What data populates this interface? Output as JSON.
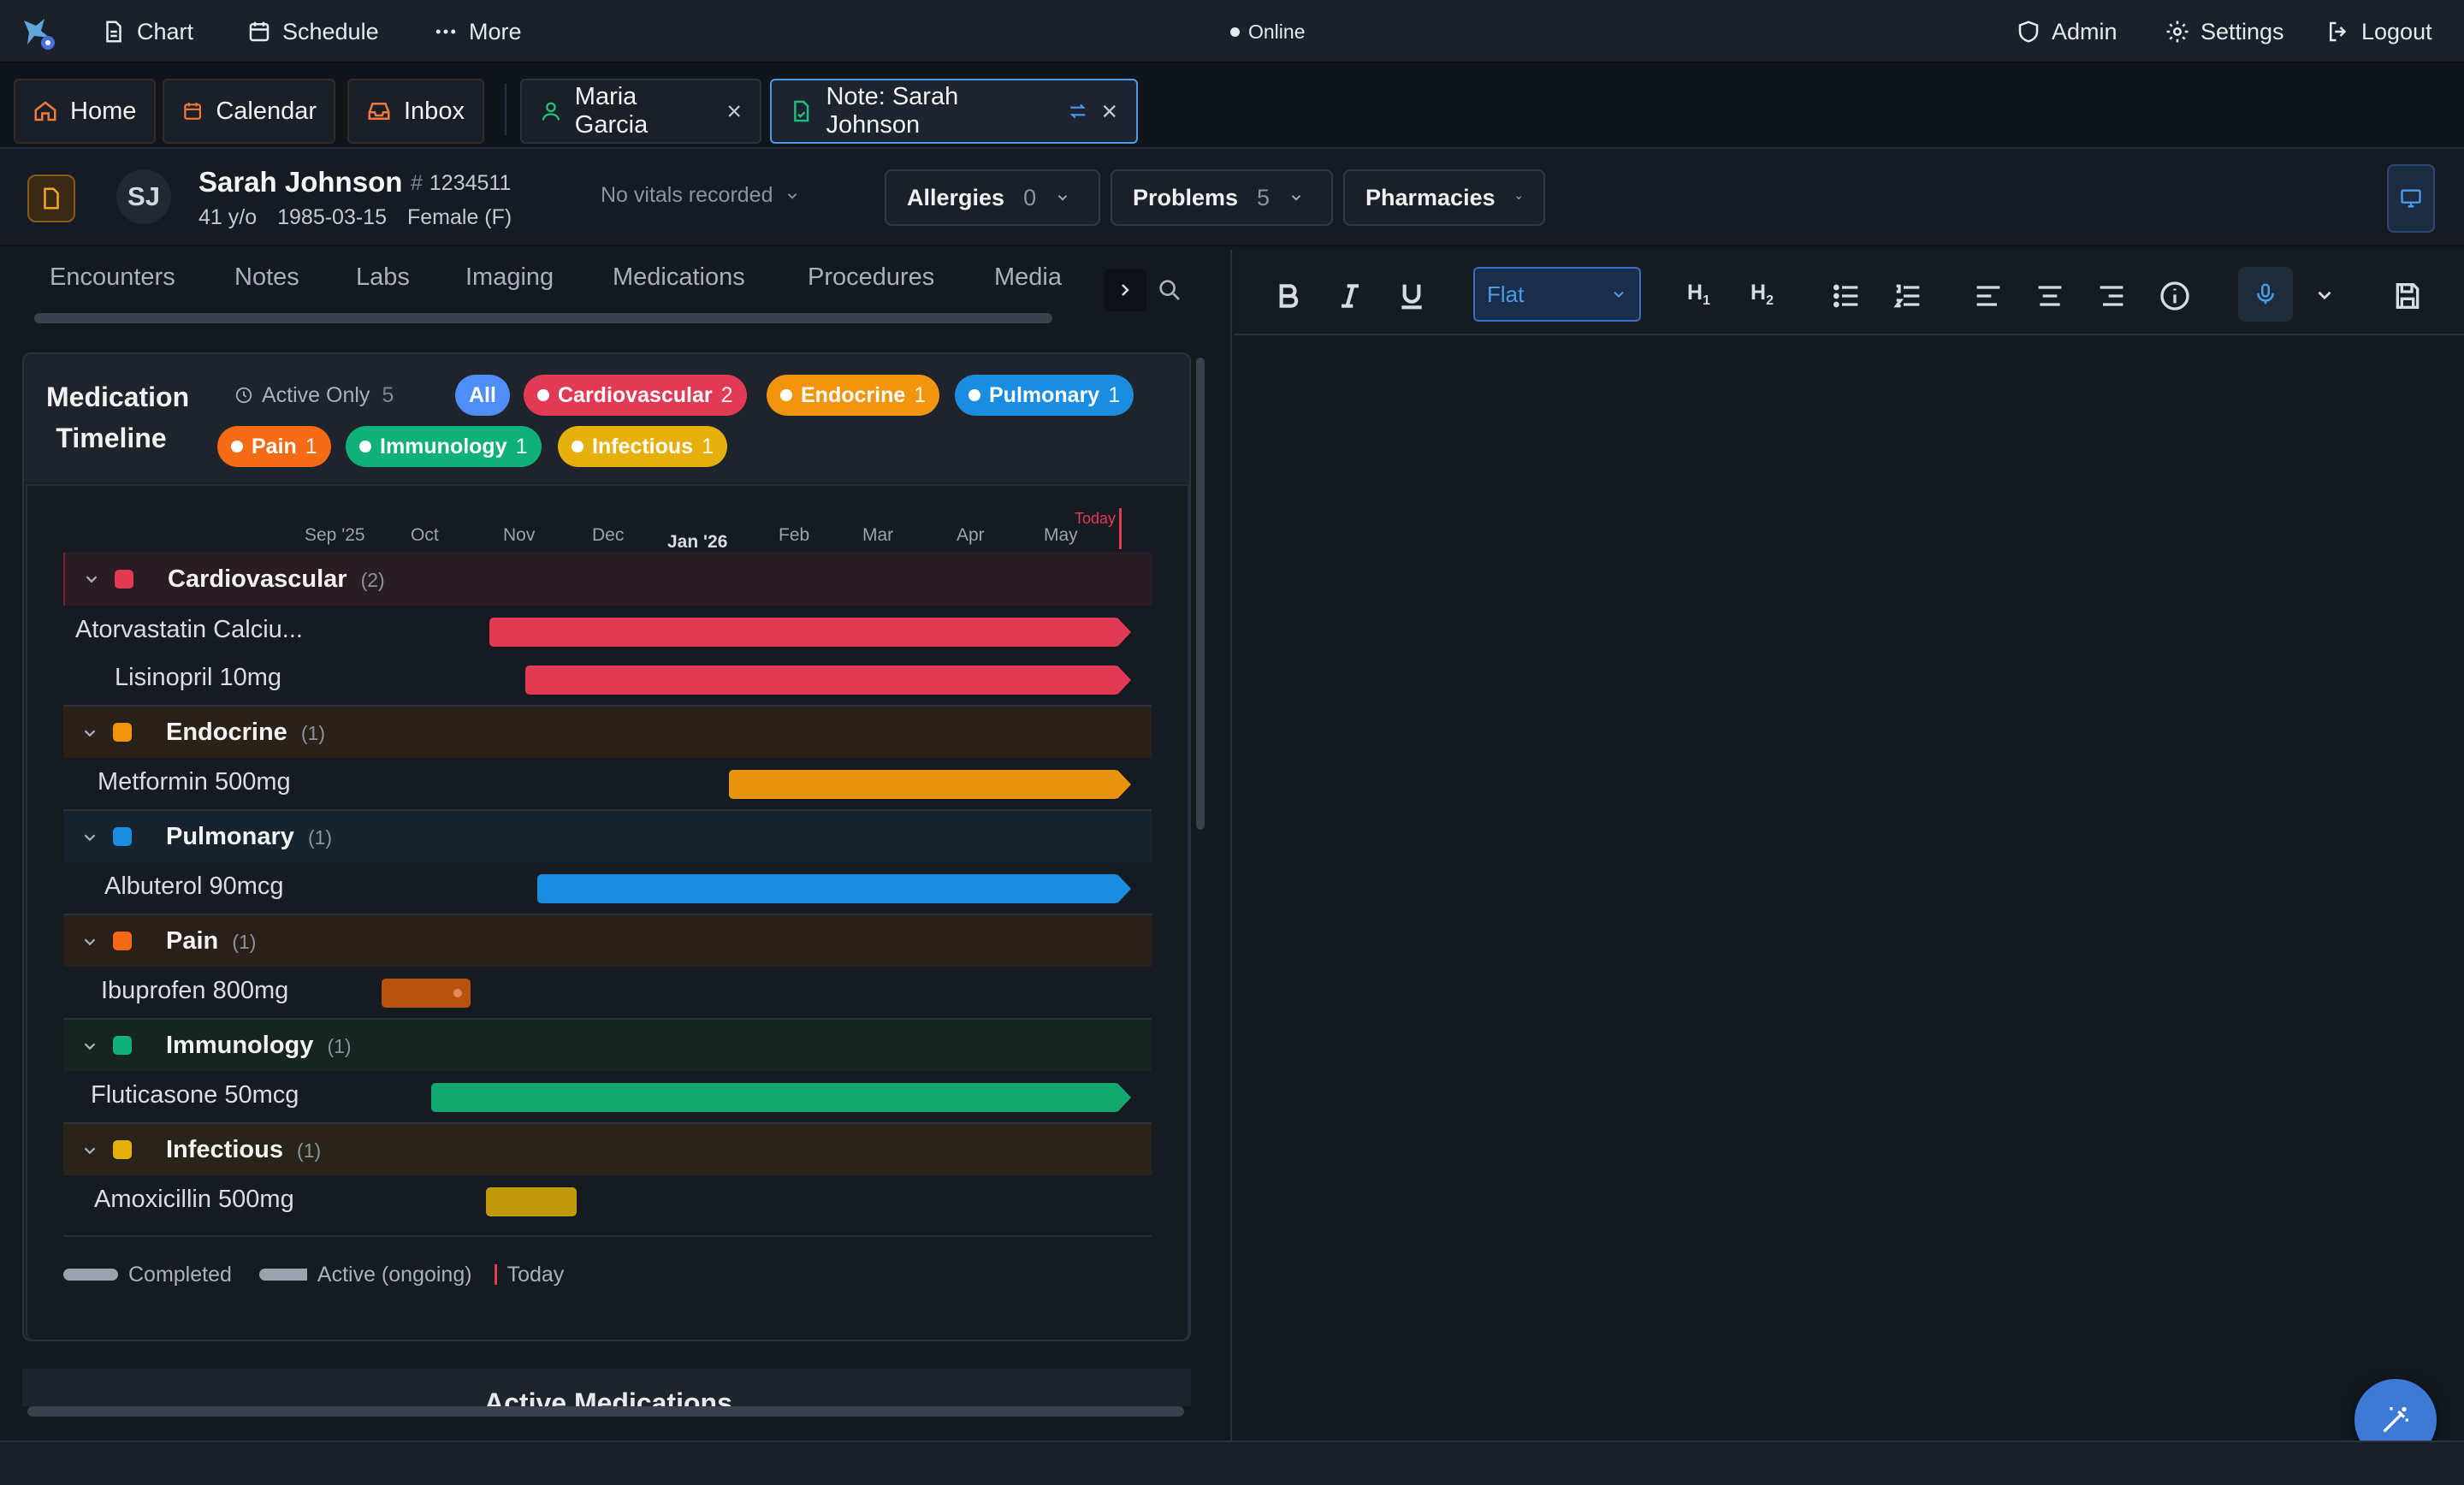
{
  "topbar": {
    "chart": "Chart",
    "schedule": "Schedule",
    "more": "More",
    "status": "Online",
    "admin": "Admin",
    "settings": "Settings",
    "logout": "Logout"
  },
  "tabs": {
    "home": "Home",
    "calendar": "Calendar",
    "inbox": "Inbox",
    "patient1": "Maria Garcia",
    "note": "Note: Sarah Johnson"
  },
  "patient": {
    "initials": "SJ",
    "name": "Sarah Johnson",
    "mrn": "1234511",
    "age": "41 y/o",
    "dob": "1985-03-15",
    "sex": "Female (F)",
    "vitals": "No vitals recorded",
    "allergies_label": "Allergies",
    "allergies_count": "0",
    "problems_label": "Problems",
    "problems_count": "5",
    "pharmacies_label": "Pharmacies"
  },
  "subtabs": [
    "Encounters",
    "Notes",
    "Labs",
    "Imaging",
    "Medications",
    "Procedures",
    "Media"
  ],
  "timeline": {
    "title_line1": "Medication",
    "title_line2": "Timeline",
    "active_only": "Active Only",
    "active_count": "5",
    "filters": [
      {
        "label": "All",
        "count": "",
        "color": "#4f8ef7"
      },
      {
        "label": "Cardiovascular",
        "count": "2",
        "color": "#e23a55"
      },
      {
        "label": "Endocrine",
        "count": "1",
        "color": "#f2950e"
      },
      {
        "label": "Pulmonary",
        "count": "1",
        "color": "#1a8de0"
      },
      {
        "label": "Pain",
        "count": "1",
        "color": "#f56a14"
      },
      {
        "label": "Immunology",
        "count": "1",
        "color": "#10b07a"
      },
      {
        "label": "Infectious",
        "count": "1",
        "color": "#e6b00c"
      }
    ],
    "axis_ticks": [
      "Sep '25",
      "Oct",
      "Nov",
      "Dec",
      "Jan '26",
      "Feb",
      "Mar",
      "Apr",
      "May"
    ],
    "today_label": "Today",
    "groups": [
      {
        "name": "Cardiovascular",
        "count": "(2)",
        "color": "#e23a55"
      },
      {
        "name": "Endocrine",
        "count": "(1)",
        "color": "#f2950e"
      },
      {
        "name": "Pulmonary",
        "count": "(1)",
        "color": "#1a8de0"
      },
      {
        "name": "Pain",
        "count": "(1)",
        "color": "#f56a14"
      },
      {
        "name": "Immunology",
        "count": "(1)",
        "color": "#10b07a"
      },
      {
        "name": "Infectious",
        "count": "(1)",
        "color": "#e6b00c"
      }
    ],
    "meds": [
      {
        "name": "Atorvastatin Calciu...",
        "status": "active",
        "color": "#e23a55"
      },
      {
        "name": "Lisinopril 10mg",
        "status": "active",
        "color": "#e23a55"
      },
      {
        "name": "Metformin 500mg",
        "status": "active",
        "color": "#e8940f"
      },
      {
        "name": "Albuterol 90mcg",
        "status": "active",
        "color": "#1a8de0"
      },
      {
        "name": "Ibuprofen 800mg",
        "status": "completed",
        "color": "#b8520f"
      },
      {
        "name": "Fluticasone 50mcg",
        "status": "active",
        "color": "#12a870"
      },
      {
        "name": "Amoxicillin 500mg",
        "status": "completed",
        "color": "#c09a0b"
      }
    ],
    "legend": {
      "completed": "Completed",
      "active": "Active (ongoing)",
      "today": "Today"
    },
    "next_section": "Active Medications"
  },
  "editor": {
    "style_select": "Flat",
    "h1": "H1",
    "h2": "H2"
  },
  "colors": {
    "accent": "#4a9be8",
    "danger": "#e23a55"
  }
}
